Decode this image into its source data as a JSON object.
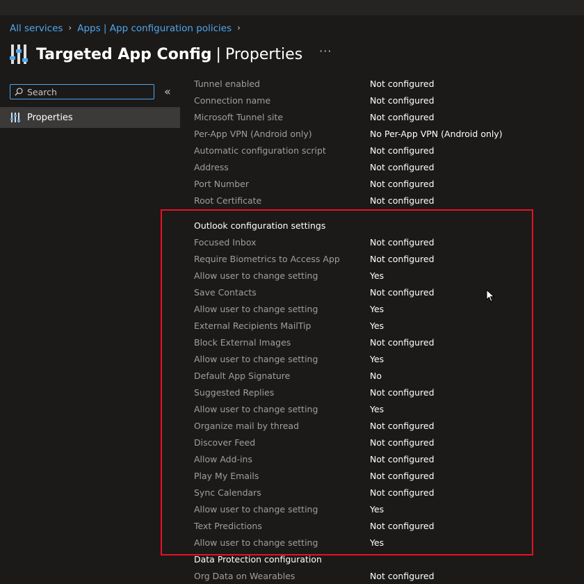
{
  "breadcrumb": [
    {
      "label": "All services"
    },
    {
      "label": "Apps | App configuration policies"
    }
  ],
  "header": {
    "icon": "sliders-icon",
    "title": "Targeted App Config",
    "separator": "|",
    "subtitle": "Properties",
    "more": "···"
  },
  "sidebar": {
    "search_placeholder": "Search",
    "collapse": "«",
    "items": [
      {
        "label": "Properties",
        "icon": "sliders-icon",
        "selected": true
      }
    ]
  },
  "properties": {
    "top_rows": [
      {
        "label": "Tunnel enabled",
        "value": "Not configured"
      },
      {
        "label": "Connection name",
        "value": "Not configured"
      },
      {
        "label": "Microsoft Tunnel site",
        "value": "Not configured"
      },
      {
        "label": "Per-App VPN (Android only)",
        "value": "No Per-App VPN (Android only)"
      },
      {
        "label": "Automatic configuration script",
        "value": "Not configured"
      },
      {
        "label": "Address",
        "value": "Not configured"
      },
      {
        "label": "Port Number",
        "value": "Not configured"
      },
      {
        "label": "Root Certificate",
        "value": "Not configured"
      }
    ],
    "outlook_section_title": "Outlook configuration settings",
    "outlook_rows": [
      {
        "label": "Focused Inbox",
        "value": "Not configured"
      },
      {
        "label": "Require Biometrics to Access App",
        "value": "Not configured"
      },
      {
        "label": "Allow user to change setting",
        "value": "Yes"
      },
      {
        "label": "Save Contacts",
        "value": "Not configured"
      },
      {
        "label": "Allow user to change setting",
        "value": "Yes"
      },
      {
        "label": "External Recipients MailTip",
        "value": "Yes"
      },
      {
        "label": "Block External Images",
        "value": "Not configured"
      },
      {
        "label": "Allow user to change setting",
        "value": "Yes"
      },
      {
        "label": "Default App Signature",
        "value": "No"
      },
      {
        "label": "Suggested Replies",
        "value": "Not configured"
      },
      {
        "label": "Allow user to change setting",
        "value": "Yes"
      },
      {
        "label": "Organize mail by thread",
        "value": "Not configured"
      },
      {
        "label": "Discover Feed",
        "value": "Not configured"
      },
      {
        "label": "Allow Add-ins",
        "value": "Not configured"
      },
      {
        "label": "Play My Emails",
        "value": "Not configured"
      },
      {
        "label": "Sync Calendars",
        "value": "Not configured"
      },
      {
        "label": "Allow user to change setting",
        "value": "Yes"
      },
      {
        "label": "Text Predictions",
        "value": "Not configured"
      },
      {
        "label": "Allow user to change setting",
        "value": "Yes"
      }
    ],
    "data_protection_title": "Data Protection configuration",
    "data_protection_rows": [
      {
        "label": "Org Data on Wearables",
        "value": "Not configured"
      }
    ]
  },
  "colors": {
    "background": "#1b1a19",
    "link": "#4fa7ee",
    "highlight_border": "#e81123",
    "selected_nav": "#3b3a39"
  }
}
